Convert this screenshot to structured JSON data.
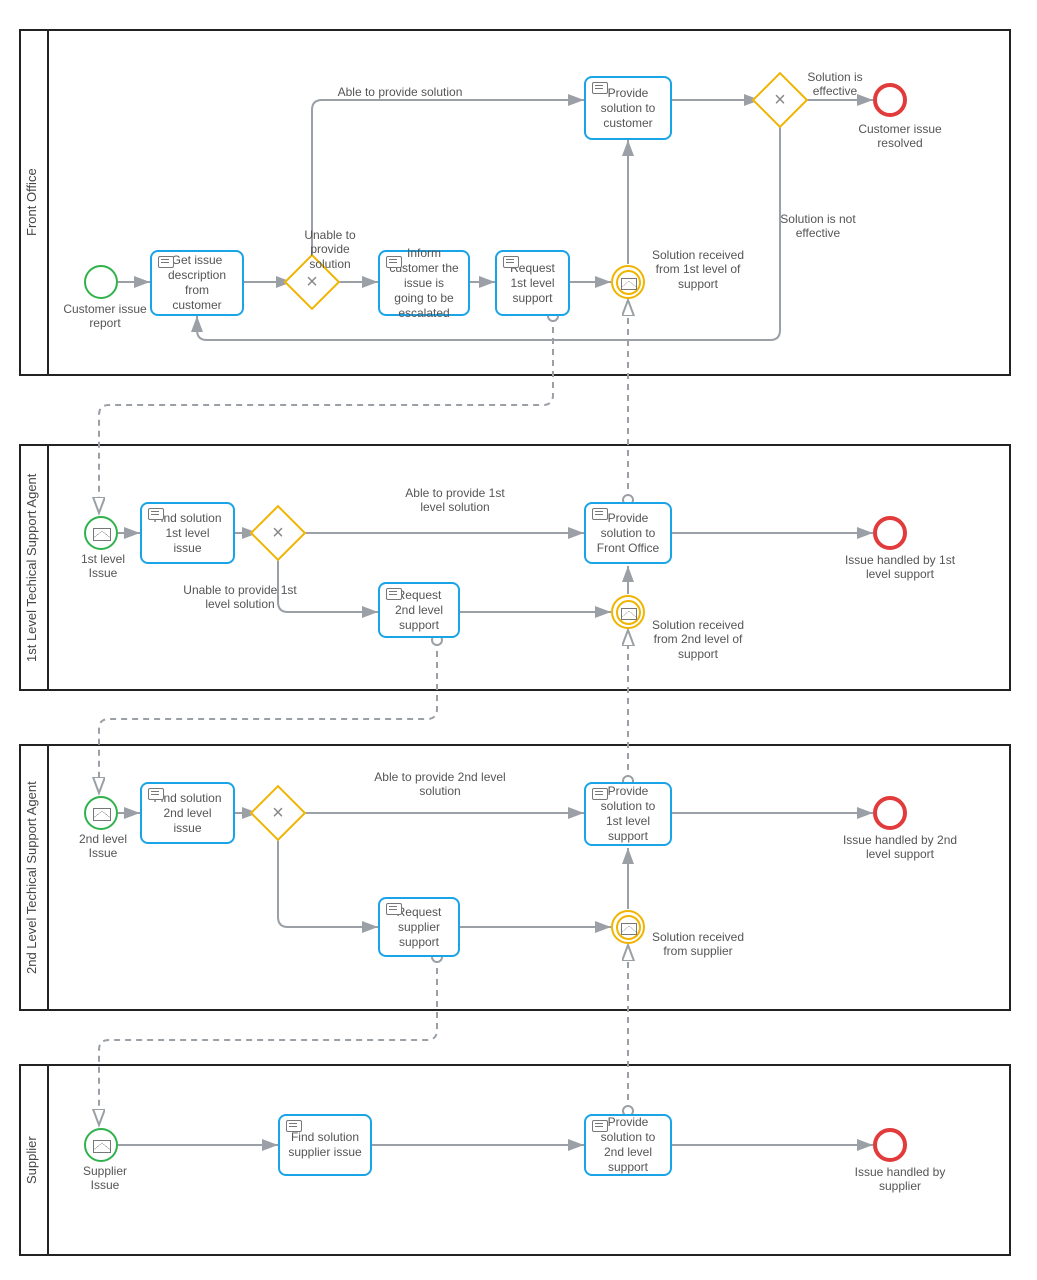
{
  "lanes": {
    "front_office": "Front Office",
    "level1": "1st Level Techical Support Agent",
    "level2": "2nd Level Techical Support Agent",
    "supplier": "Supplier"
  },
  "front": {
    "start_label": "Customer issue report",
    "task_get_issue": "Get issue description from customer",
    "gw_able_label": "Able to  provide solution",
    "gw_unable_label": "Unable to provide solution",
    "task_inform": "Inform customer the issue is going to be escalated",
    "task_request1": "Request 1st level support",
    "msg_wait_label": "Solution received from 1st level of support",
    "task_provide": "Provide solution to customer",
    "gw2_eff_label": "Solution is effective",
    "gw2_noteff_label": "Solution is not effective",
    "end_label": "Customer issue resolved"
  },
  "l1": {
    "start_label": "1st level Issue",
    "task_find": "Find solution 1st level issue",
    "gw_able": "Able to provide 1st level solution",
    "gw_unable": "Unable to provide 1st level solution",
    "task_request2": "Request 2nd level support",
    "msg_wait": "Solution received from 2nd level of support",
    "task_provide": "Provide solution to Front Office",
    "end_label": "Issue handled by 1st level support"
  },
  "l2": {
    "start_label": "2nd  level Issue",
    "task_find": "Find solution 2nd level issue",
    "gw_able": "Able to provide 2nd level solution",
    "task_request": "Request supplier support",
    "msg_wait": "Solution received from supplier",
    "task_provide": "Provide solution to 1st level support",
    "end_label": "Issue handled by  2nd level support"
  },
  "sup": {
    "start_label": "Supplier Issue",
    "task_find": "Find solution supplier issue",
    "task_provide": "Provide solution to 2nd level support",
    "end_label": "Issue handled by supplier"
  }
}
